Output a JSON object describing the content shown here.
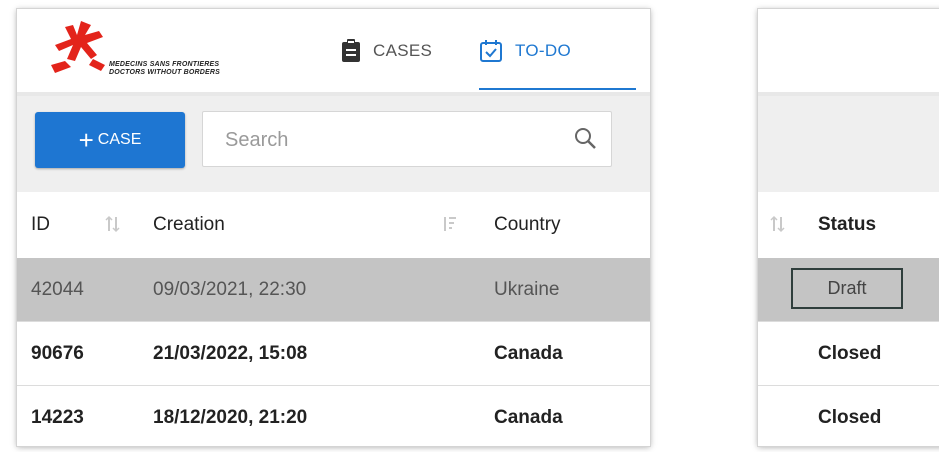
{
  "brand": {
    "logo_line1": "MEDECINS SANS FRONTIERES",
    "logo_line2": "DOCTORS WITHOUT BORDERS",
    "brand_color": "#e3241b"
  },
  "nav": {
    "tabs": [
      {
        "label": "CASES",
        "icon": "clipboard-icon",
        "active": false
      },
      {
        "label": "TO-DO",
        "icon": "checkbox-calendar-icon",
        "active": true
      }
    ]
  },
  "toolbar": {
    "add_label": "CASE",
    "add_prefix": "+",
    "search_placeholder": "Search"
  },
  "table": {
    "columns": [
      {
        "label": "ID"
      },
      {
        "label": "Creation"
      },
      {
        "label": "Country"
      },
      {
        "label": "Status"
      }
    ],
    "rows": [
      {
        "id": "42044",
        "creation": "09/03/2021, 22:30",
        "country": "Ukraine",
        "status": "Draft",
        "selected": true
      },
      {
        "id": "90676",
        "creation": "21/03/2022, 15:08",
        "country": "Canada",
        "status": "Closed",
        "selected": false
      },
      {
        "id": "14223",
        "creation": "18/12/2020, 21:20",
        "country": "Canada",
        "status": "Closed",
        "selected": false
      }
    ]
  },
  "colors": {
    "accent": "#1f78d1",
    "selected_row": "#c4c4c4",
    "toolbar_bg": "#efefef"
  }
}
